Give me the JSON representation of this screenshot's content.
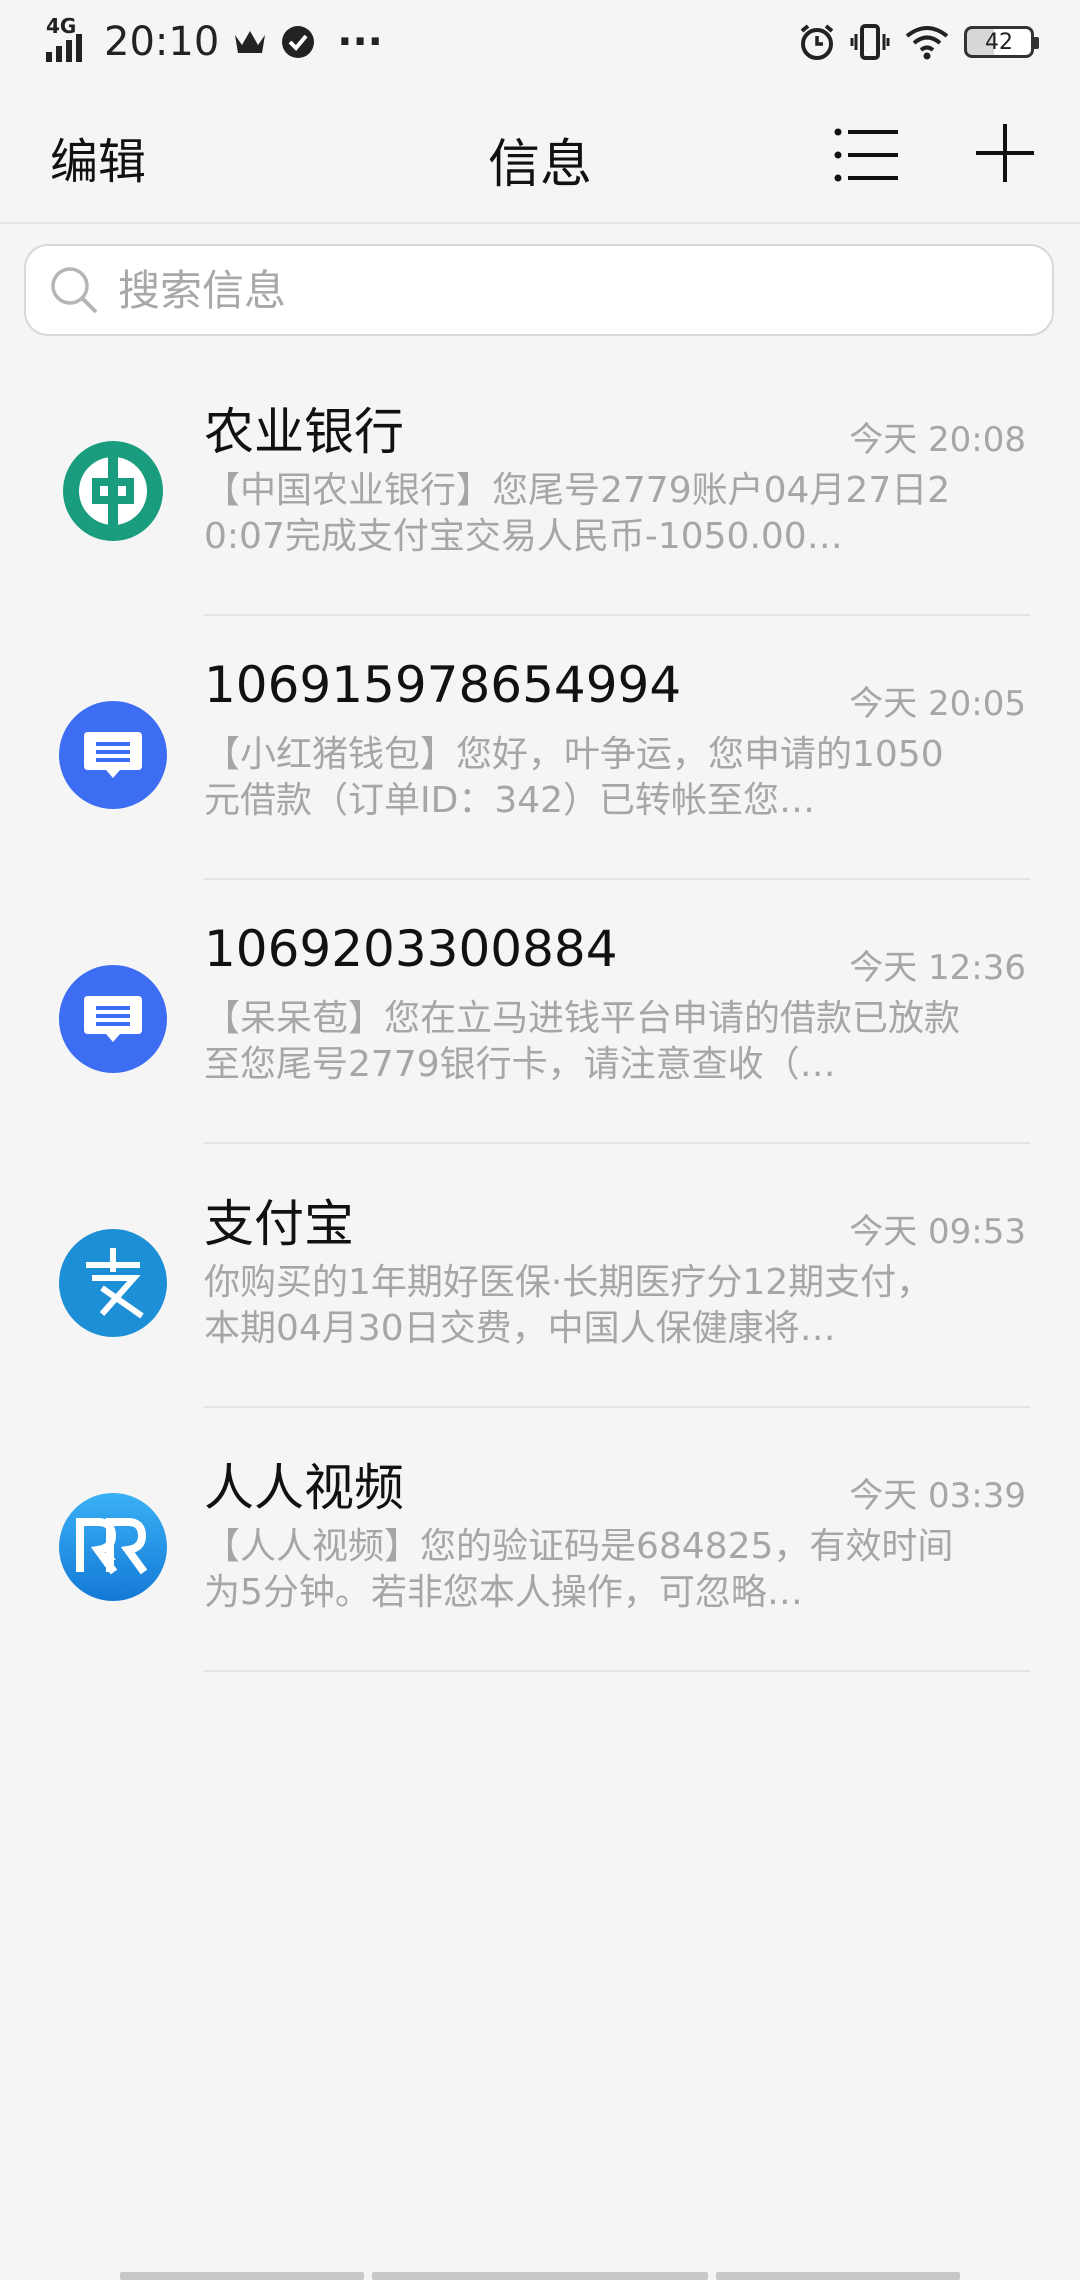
{
  "status_bar": {
    "network": "4G",
    "time": "20:10",
    "more": "···",
    "battery": "42"
  },
  "header": {
    "edit_label": "编辑",
    "title": "信息",
    "menu_icon": "list-menu-icon",
    "add_icon": "plus-icon"
  },
  "search": {
    "placeholder": "搜索信息",
    "value": ""
  },
  "conversations": [
    {
      "sender": "农业银行",
      "time": "今天 20:08",
      "preview": "【中国农业银行】您尾号2779账户04月27日20:07完成支付宝交易人民币-1050.00…",
      "avatar": "abc-bank-logo",
      "color": "#1a9c7f"
    },
    {
      "sender": "106915978654994",
      "time": "今天 20:05",
      "preview": "【小红猪钱包】您好，叶争运，您申请的1050元借款（订单ID：342）已转帐至您…",
      "avatar": "message-icon",
      "color": "#3d6df2"
    },
    {
      "sender": "1069203300884",
      "time": "今天 12:36",
      "preview": "【呆呆苞】您在立马进钱平台申请的借款已放款至您尾号2779银行卡，请注意查收（…",
      "avatar": "message-icon",
      "color": "#3d6df2"
    },
    {
      "sender": "支付宝",
      "time": "今天 09:53",
      "preview": "你购买的1年期好医保·长期医疗分12期支付，本期04月30日交费，中国人保健康将…",
      "avatar": "alipay-logo",
      "color": "#1d8fd6"
    },
    {
      "sender": "人人视频",
      "time": "今天 03:39",
      "preview": "【人人视频】您的验证码是684825，有效时间为5分钟。若非您本人操作，可忽略…",
      "avatar": "renren-video-logo",
      "color": "#1c97ea"
    }
  ]
}
